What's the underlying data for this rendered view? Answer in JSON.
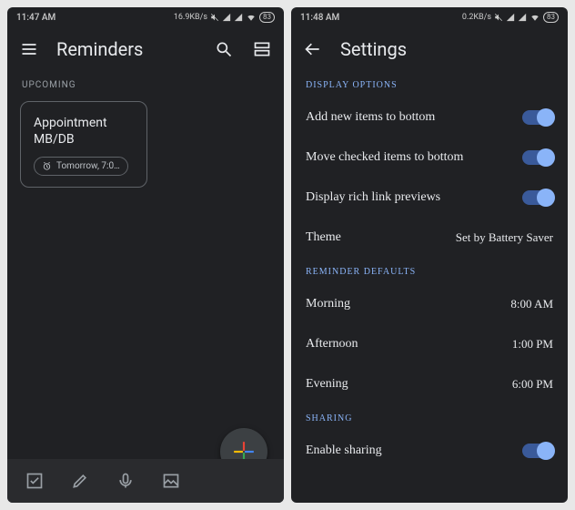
{
  "left": {
    "status": {
      "time": "11:47 AM",
      "net": "16.9KB/s",
      "battery": "83"
    },
    "title": "Reminders",
    "section": "UPCOMING",
    "card": {
      "title": "Appointment MB/DB",
      "chip": "Tomorrow, 7:0…"
    }
  },
  "right": {
    "status": {
      "time": "11:48 AM",
      "net": "0.2KB/s",
      "battery": "83"
    },
    "title": "Settings",
    "sections": {
      "display": "DISPLAY OPTIONS",
      "reminder": "REMINDER DEFAULTS",
      "sharing": "SHARING"
    },
    "rows": {
      "addBottom": "Add new items to bottom",
      "moveChecked": "Move checked items to bottom",
      "richLink": "Display rich link previews",
      "themeLabel": "Theme",
      "themeValue": "Set by Battery Saver",
      "morningLabel": "Morning",
      "morningValue": "8:00 AM",
      "afternoonLabel": "Afternoon",
      "afternoonValue": "1:00 PM",
      "eveningLabel": "Evening",
      "eveningValue": "6:00 PM",
      "enableSharing": "Enable sharing"
    }
  }
}
